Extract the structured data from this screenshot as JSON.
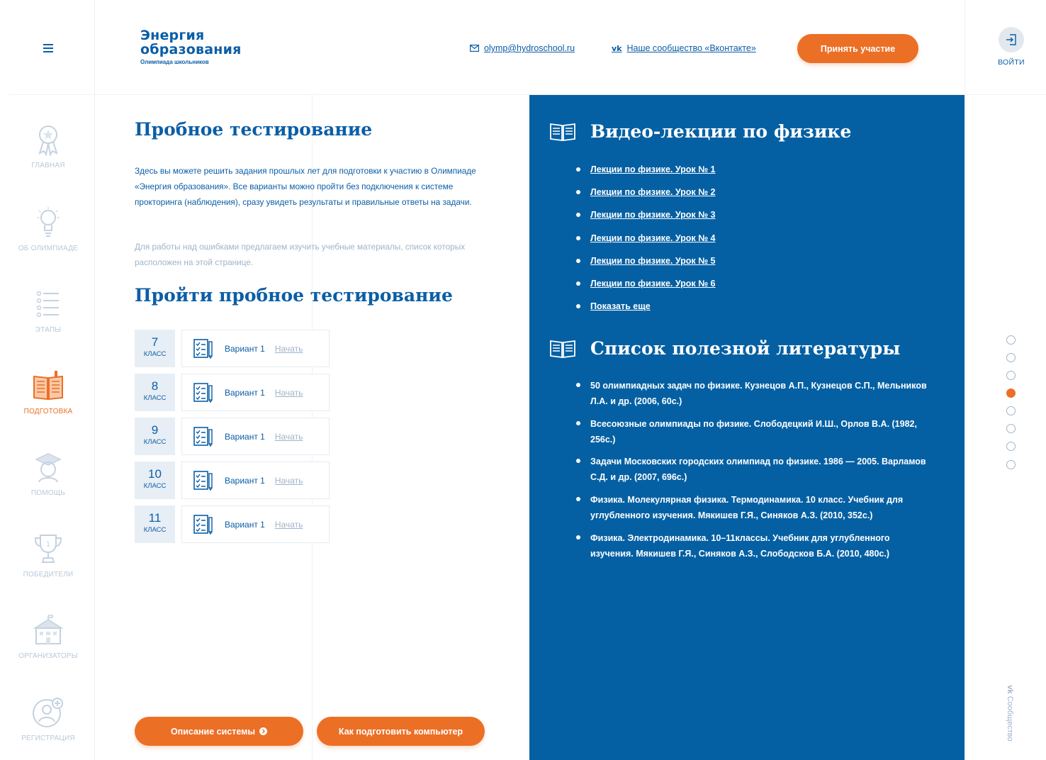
{
  "header": {
    "logo_line1": "Энергия",
    "logo_line2": "образования",
    "logo_sub": "Олимпиада школьников",
    "email": "olymp@hydroschool.ru",
    "vk_link": "Наше сообщество «Вконтакте»",
    "participate_button": "Принять участие",
    "login_label": "ВОЙТИ"
  },
  "nav": [
    {
      "label": "ГЛАВНАЯ"
    },
    {
      "label": "ОБ ОЛИМПИАДЕ"
    },
    {
      "label": "ЭТАПЫ"
    },
    {
      "label": "ПОДГОТОВКА"
    },
    {
      "label": "ПОМОЩЬ"
    },
    {
      "label": "ПОБЕДИТЕЛИ"
    },
    {
      "label": "ОРГАНИЗАТОРЫ"
    },
    {
      "label": "РЕГИСТРАЦИЯ"
    }
  ],
  "main": {
    "title": "Пробное тестирование",
    "intro": "Здесь вы можете решить задания прошлых лет для подготовки к участию в Олимпиаде «Энергия образования». Все варианты можно пройти без подключения к системе прокторинга (наблюдения), сразу увидеть результаты и правильные ответы на задачи.",
    "intro_note": "Для работы над ошибками предлагаем изучить учебные материалы, список которых расположен на этой странице.",
    "test_title": "Пройти пробное тестирование",
    "grade_label": "КЛАСС",
    "grades": [
      {
        "num": "7",
        "variant": "Вариант 1",
        "start": "Начать"
      },
      {
        "num": "8",
        "variant": "Вариант 1",
        "start": "Начать"
      },
      {
        "num": "9",
        "variant": "Вариант 1",
        "start": "Начать"
      },
      {
        "num": "10",
        "variant": "Вариант 1",
        "start": "Начать"
      },
      {
        "num": "11",
        "variant": "Вариант 1",
        "start": "Начать"
      }
    ],
    "btn_system": "Описание системы",
    "btn_prepare": "Как подготовить компьютер"
  },
  "panel": {
    "video_title": "Видео-лекции по физике",
    "lectures": [
      "Лекции по физике. Урок № 1",
      "Лекции по физике. Урок № 2",
      "Лекции по физике. Урок № 3",
      "Лекции по физике. Урок № 4",
      "Лекции по физике. Урок № 5",
      "Лекции по физике. Урок № 6",
      "Показать еще"
    ],
    "lit_title": "Список полезной литературы",
    "literature": [
      "50 олимпиадных задач по физике. Кузнецов А.П., Кузнецов С.П., Мельников Л.А. и др. (2006, 60с.)",
      "Всесоюзные олимпиады по физике. Слободецкий И.Ш., Орлов В.А. (1982, 256с.)",
      "Задачи Московских городских олимпиад по физике. 1986 — 2005. Варламов С.Д. и др. (2007, 696с.)",
      "Физика. Молекулярная физика. Термодинамика. 10 класс. Учебник для углубленного изучения. Мякишев Г.Я., Синяков А.З. (2010, 352с.)",
      "Физика. Электродинамика. 10–11классы. Учебник для углубленного изучения. Мякишев Г.Я., Синяков А.З., Слободсков Б.А. (2010, 480с.)"
    ]
  },
  "side": {
    "community": "Сообщество"
  },
  "colors": {
    "primary": "#0b5ea6",
    "accent": "#ec6f26",
    "panel": "#0560a3",
    "muted": "#9fb4c9"
  }
}
